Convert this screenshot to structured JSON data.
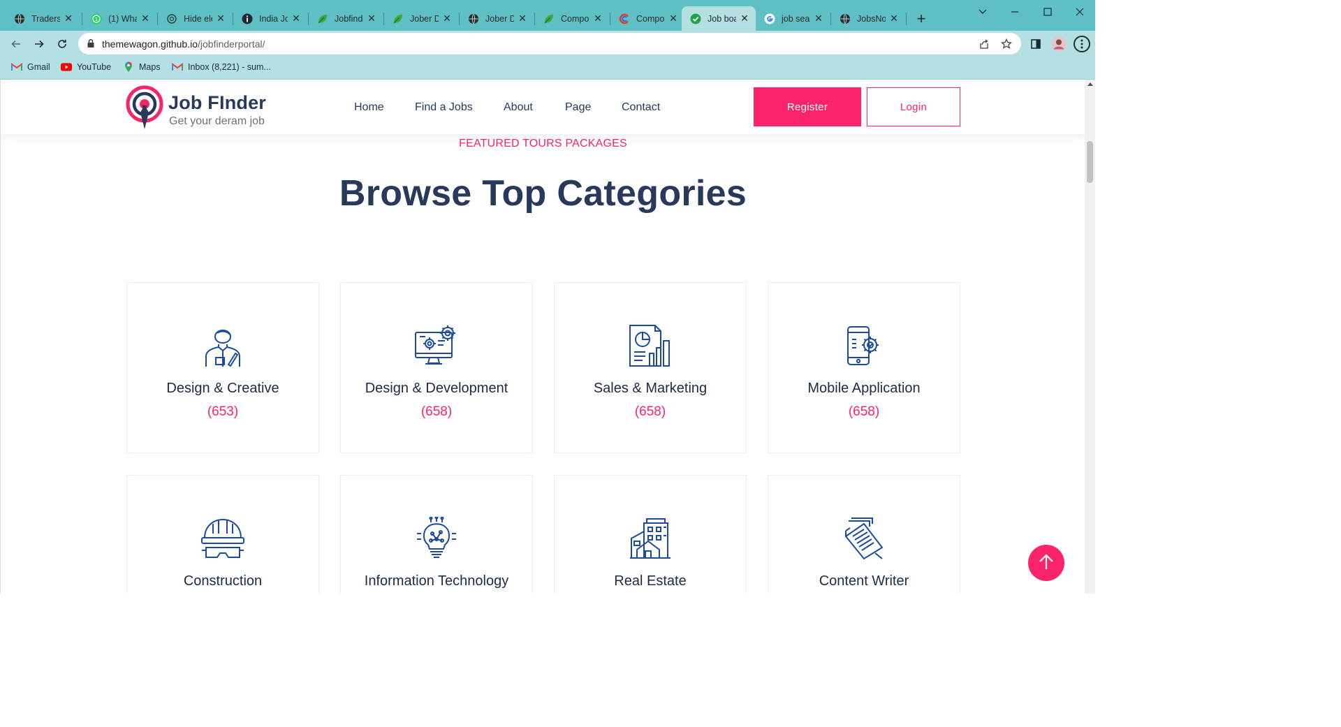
{
  "browser": {
    "tabs": [
      {
        "title": "Traders",
        "icon": "globe-icon"
      },
      {
        "title": "(1) Wha",
        "icon": "whatsapp-icon"
      },
      {
        "title": "Hide ele",
        "icon": "openai-icon"
      },
      {
        "title": "India Jo",
        "icon": "info-icon"
      },
      {
        "title": "Jobfinde",
        "icon": "green-leaf-icon"
      },
      {
        "title": "Jober D",
        "icon": "green-leaf-icon"
      },
      {
        "title": "Jober D",
        "icon": "globe-icon"
      },
      {
        "title": "Compo",
        "icon": "green-leaf-icon"
      },
      {
        "title": "Compo",
        "icon": "codepen-c-icon"
      },
      {
        "title": "Job boa",
        "icon": "check-circle-icon",
        "active": true
      },
      {
        "title": "job sear",
        "icon": "google-icon"
      },
      {
        "title": "JobsNo",
        "icon": "globe-icon"
      }
    ],
    "close_glyph": "✕",
    "new_tab_glyph": "+",
    "url": {
      "host": "themewagon.github.io",
      "path": "/jobfinderportal/"
    },
    "bookmarks": [
      {
        "label": "Gmail",
        "icon": "gmail-icon"
      },
      {
        "label": "YouTube",
        "icon": "youtube-icon"
      },
      {
        "label": "Maps",
        "icon": "maps-pin-icon"
      },
      {
        "label": "Inbox (8,221) - sum...",
        "icon": "gmail-icon"
      }
    ]
  },
  "site": {
    "brand": "Job FInder",
    "tagline": "Get your deram job",
    "nav": [
      "Home",
      "Find a Jobs",
      "About",
      "Page",
      "Contact"
    ],
    "register_label": "Register",
    "login_label": "Login",
    "accent_color": "#fb246a",
    "heading_color": "#28395a"
  },
  "section": {
    "eyebrow": "FEATURED TOURS PACKAGES",
    "title": "Browse Top Categories",
    "categories": [
      {
        "name": "Design & Creative",
        "count": "(653)",
        "icon": "designer-person-icon"
      },
      {
        "name": "Design & Development",
        "count": "(658)",
        "icon": "monitor-gears-icon"
      },
      {
        "name": "Sales & Marketing",
        "count": "(658)",
        "icon": "sales-report-icon"
      },
      {
        "name": "Mobile Application",
        "count": "(658)",
        "icon": "mobile-gear-icon"
      },
      {
        "name": "Construction",
        "count": "",
        "icon": "hardhat-goggles-icon"
      },
      {
        "name": "Information Technology",
        "count": "",
        "icon": "lightbulb-circuit-icon"
      },
      {
        "name": "Real Estate",
        "count": "",
        "icon": "buildings-icon"
      },
      {
        "name": "Content Writer",
        "count": "",
        "icon": "documents-pen-icon"
      }
    ]
  }
}
